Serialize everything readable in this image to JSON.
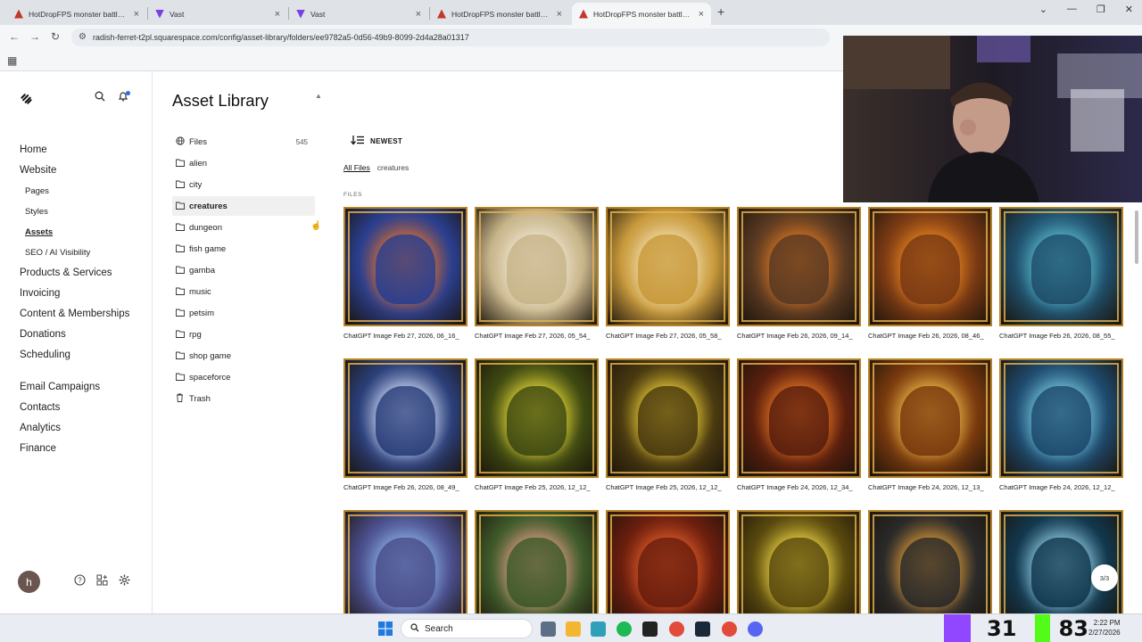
{
  "browser": {
    "tabs": [
      {
        "title": "HotDropFPS monster battle style",
        "active": false,
        "favicon_color": "#c0392b"
      },
      {
        "title": "Vast",
        "active": false,
        "favicon_color": "#7b3fe4"
      },
      {
        "title": "Vast",
        "active": false,
        "favicon_color": "#7b3fe4"
      },
      {
        "title": "HotDropFPS monster battle style",
        "active": false,
        "favicon_color": "#c0392b"
      },
      {
        "title": "HotDropFPS monster battle style",
        "active": true,
        "favicon_color": "#c0392b"
      }
    ],
    "url": "radish-ferret-t2pl.squarespace.com/config/asset-library/folders/ee9782a5-0d56-49b9-8099-2d4a28a01317"
  },
  "leftnav": {
    "logo_icon": "squarespace-logo-icon",
    "primary": [
      {
        "label": "Home",
        "active": false
      },
      {
        "label": "Website",
        "active": false
      }
    ],
    "website_sub": [
      {
        "label": "Pages",
        "active": false
      },
      {
        "label": "Styles",
        "active": false
      },
      {
        "label": "Assets",
        "active": true
      },
      {
        "label": "SEO / AI Visibility",
        "active": false
      }
    ],
    "secondary": [
      {
        "label": "Products & Services"
      },
      {
        "label": "Invoicing"
      },
      {
        "label": "Content & Memberships"
      },
      {
        "label": "Donations"
      },
      {
        "label": "Scheduling"
      }
    ],
    "tertiary": [
      {
        "label": "Email Campaigns"
      },
      {
        "label": "Contacts"
      },
      {
        "label": "Analytics"
      },
      {
        "label": "Finance"
      }
    ],
    "avatar_initial": "h"
  },
  "asset_panel": {
    "title": "Asset Library",
    "files_label": "Files",
    "files_count": "545",
    "folders": [
      "alien",
      "city",
      "creatures",
      "dungeon",
      "fish game",
      "gamba",
      "music",
      "petsim",
      "rpg",
      "shop game",
      "spaceforce"
    ],
    "selected_folder": "creatures",
    "trash_label": "Trash"
  },
  "main": {
    "sort_label": "NEWEST",
    "breadcrumb_root": "All Files",
    "breadcrumb_current": "creatures",
    "section_label": "FILES",
    "pager_label": "3/3",
    "files": [
      {
        "caption": "ChatGPT Image Feb 27, 2026, 06_16_",
        "hue": "#2a3f8f",
        "accent": "#e8722a"
      },
      {
        "caption": "ChatGPT Image Feb 27, 2026, 05_54_",
        "hue": "#c8b58a",
        "accent": "#f2ead6"
      },
      {
        "caption": "ChatGPT Image Feb 27, 2026, 05_58_",
        "hue": "#c99a3c",
        "accent": "#f4e3b6"
      },
      {
        "caption": "ChatGPT Image Feb 26, 2026, 09_14_",
        "hue": "#5a3a22",
        "accent": "#e07a24"
      },
      {
        "caption": "ChatGPT Image Feb 26, 2026, 08_46_",
        "hue": "#7a3a14",
        "accent": "#f08a20"
      },
      {
        "caption": "ChatGPT Image Feb 26, 2026, 08_55_",
        "hue": "#1f4f6b",
        "accent": "#5fc2d6"
      },
      {
        "caption": "ChatGPT Image Feb 26, 2026, 08_49_",
        "hue": "#2b3f7a",
        "accent": "#d9e4ff"
      },
      {
        "caption": "ChatGPT Image Feb 25, 2026, 12_12_",
        "hue": "#3f4a12",
        "accent": "#f2e23a"
      },
      {
        "caption": "ChatGPT Image Feb 25, 2026, 12_12_",
        "hue": "#4a3a10",
        "accent": "#f5d63a"
      },
      {
        "caption": "ChatGPT Image Feb 24, 2026, 12_34_",
        "hue": "#5a1f0e",
        "accent": "#f07a24"
      },
      {
        "caption": "ChatGPT Image Feb 24, 2026, 12_13_",
        "hue": "#7a3a0e",
        "accent": "#f8c24a"
      },
      {
        "caption": "ChatGPT Image Feb 24, 2026, 12_12_",
        "hue": "#1e4a6e",
        "accent": "#7ad0e6"
      },
      {
        "caption": "",
        "hue": "#4a4e8a",
        "accent": "#8fb8f0"
      },
      {
        "caption": "",
        "hue": "#3e5a2a",
        "accent": "#e6a08a"
      },
      {
        "caption": "",
        "hue": "#6a1e0e",
        "accent": "#e8602a"
      },
      {
        "caption": "",
        "hue": "#5a4a0e",
        "accent": "#f8e04a"
      },
      {
        "caption": "",
        "hue": "#2a2a2a",
        "accent": "#e8a03a"
      },
      {
        "caption": "",
        "hue": "#12384e",
        "accent": "#9ad8f0"
      }
    ]
  },
  "taskbar": {
    "search_label": "Search",
    "counter_left": "31",
    "counter_right": "83",
    "clock_time": "2:22 PM",
    "clock_date": "2/27/2026"
  }
}
